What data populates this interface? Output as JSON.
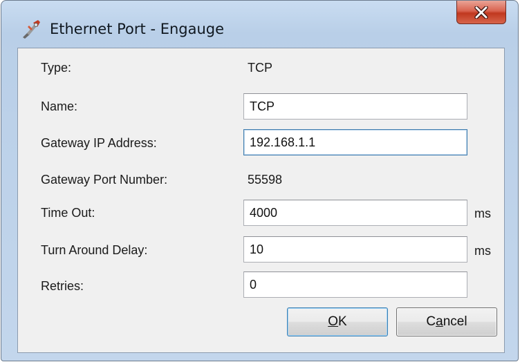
{
  "window": {
    "title": "Ethernet Port - Engauge",
    "app_icon": "engauge-app-icon",
    "close_icon": "close-icon",
    "colors": {
      "frame": "#c3d6ec",
      "close_button": "#c0381f",
      "client": "#f0f0f0"
    }
  },
  "form": {
    "type": {
      "label": "Type:",
      "value": "TCP"
    },
    "name": {
      "label": "Name:",
      "value": "TCP"
    },
    "gateway_ip": {
      "label": "Gateway IP Address:",
      "value": "192.168.1.1"
    },
    "gateway_port": {
      "label": "Gateway Port Number:",
      "value": "55598"
    },
    "time_out": {
      "label": "Time Out:",
      "value": "4000",
      "unit": "ms"
    },
    "turn_around_delay": {
      "label": "Turn Around Delay:",
      "value": "10",
      "unit": "ms"
    },
    "retries": {
      "label": "Retries:",
      "value": "0"
    }
  },
  "buttons": {
    "ok": {
      "mnemonic": "O",
      "rest": "K"
    },
    "cancel": {
      "before": "C",
      "mnemonic": "a",
      "rest": "ncel"
    }
  }
}
